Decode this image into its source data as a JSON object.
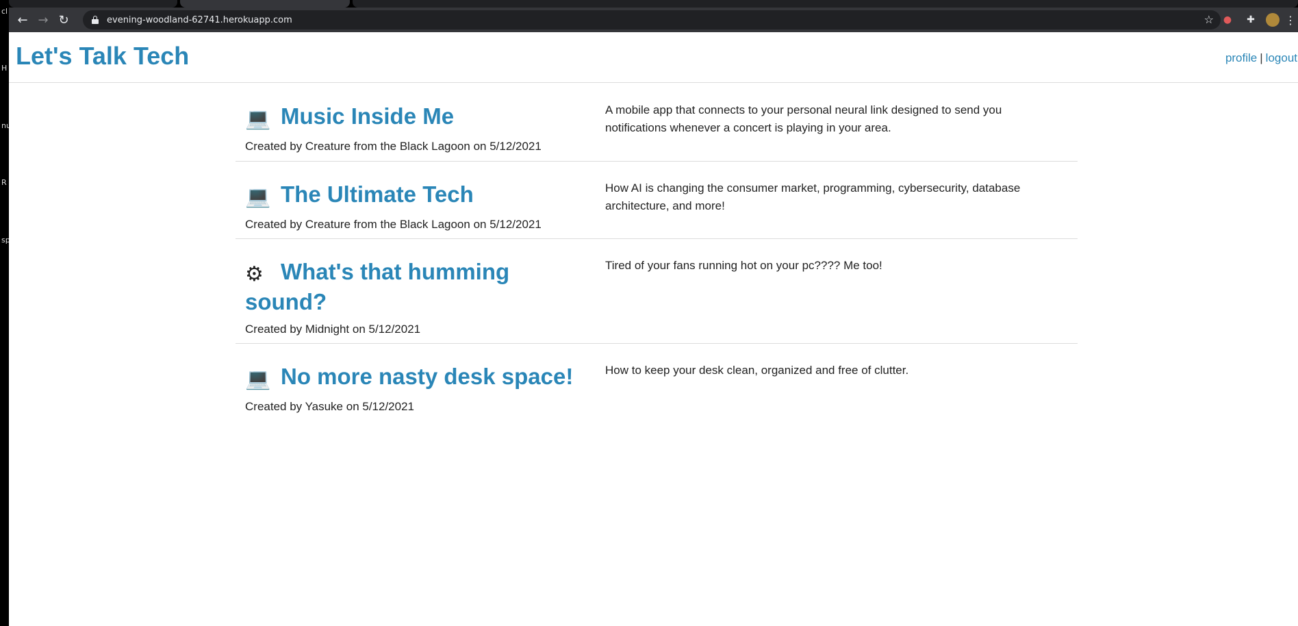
{
  "browser": {
    "url": "evening-woodland-62741.herokuapp.com"
  },
  "desktop_fragments": [
    "cl",
    "H",
    "nu",
    "R",
    "sp"
  ],
  "site": {
    "title": "Let's Talk Tech",
    "nav": {
      "profile": "profile",
      "separator": "|",
      "logout": "logout"
    }
  },
  "posts": [
    {
      "icon": "laptop-icon",
      "icon_glyph": "💻",
      "title": "Music Inside Me",
      "meta": "Created by Creature from the Black Lagoon on 5/12/2021",
      "description": "A mobile app that connects to your personal neural link designed to send you notifications whenever a concert is playing in your area."
    },
    {
      "icon": "laptop-icon",
      "icon_glyph": "💻",
      "title": "The Ultimate Tech",
      "meta": "Created by Creature from the Black Lagoon on 5/12/2021",
      "description": "How AI is changing the consumer market, programming, cybersecurity, database architecture, and more!"
    },
    {
      "icon": "gear-icon",
      "icon_glyph": "⚙",
      "title": "What's that humming sound?",
      "meta": "Created by Midnight on 5/12/2021",
      "description": "Tired of your fans running hot on your pc???? Me too!"
    },
    {
      "icon": "laptop-icon",
      "icon_glyph": "💻",
      "title": "No more nasty desk space!",
      "meta": "Created by Yasuke on 5/12/2021",
      "description": "How to keep your desk clean, organized and free of clutter."
    }
  ]
}
